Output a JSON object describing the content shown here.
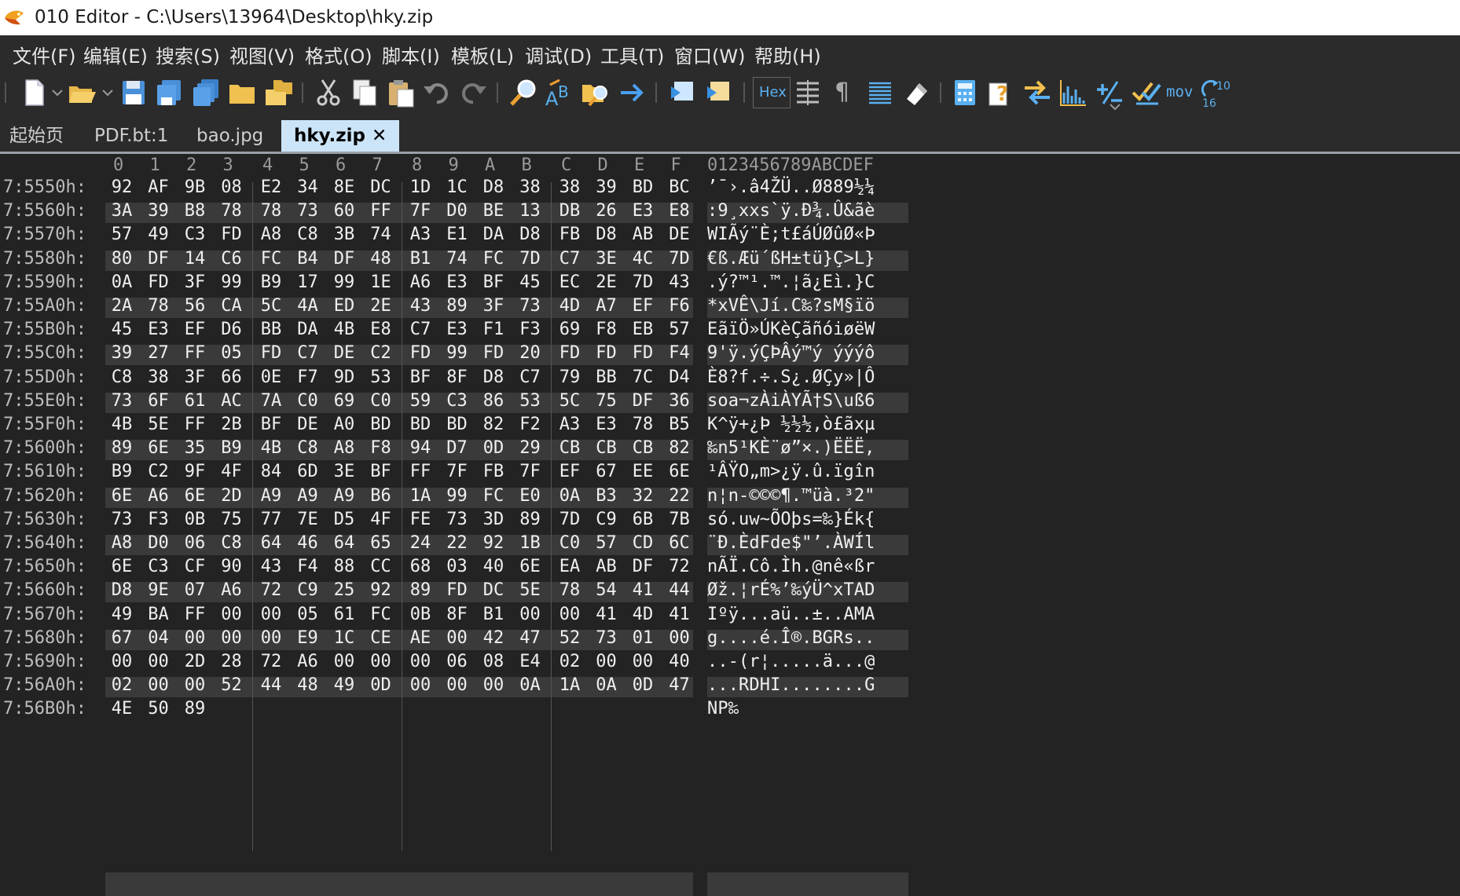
{
  "window": {
    "title": "010 Editor - C:\\Users\\13964\\Desktop\\hky.zip"
  },
  "menu": [
    "文件(F)",
    "编辑(E)",
    "搜索(S)",
    "视图(V)",
    "格式(O)",
    "脚本(I)",
    "模板(L)",
    "调试(D)",
    "工具(T)",
    "窗口(W)",
    "帮助(H)"
  ],
  "toolbar": {
    "hex_label": "Hex",
    "mov_label": "mov",
    "pilcrow": "¶"
  },
  "tabs": [
    {
      "label": "起始页"
    },
    {
      "label": "PDF.bt:1"
    },
    {
      "label": "bao.jpg"
    },
    {
      "label": "hky.zip",
      "close": "✕"
    }
  ],
  "hex_header": {
    "columns": [
      "0",
      "1",
      "2",
      "3",
      "4",
      "5",
      "6",
      "7",
      "8",
      "9",
      "A",
      "B",
      "C",
      "D",
      "E",
      "F"
    ],
    "ascii_header": "0123456789ABCDEF"
  },
  "rows": [
    {
      "addr": "7:5550h:",
      "bytes": [
        "92",
        "AF",
        "9B",
        "08",
        "E2",
        "34",
        "8E",
        "DC",
        "1D",
        "1C",
        "D8",
        "38",
        "38",
        "39",
        "BD",
        "BC"
      ],
      "ascii": "’¯›.â4ŽÜ..Ø889½¼"
    },
    {
      "addr": "7:5560h:",
      "bytes": [
        "3A",
        "39",
        "B8",
        "78",
        "78",
        "73",
        "60",
        "FF",
        "7F",
        "D0",
        "BE",
        "13",
        "DB",
        "26",
        "E3",
        "E8"
      ],
      "ascii": ":9¸xxs`ÿ.Ð¾.Û&ãè"
    },
    {
      "addr": "7:5570h:",
      "bytes": [
        "57",
        "49",
        "C3",
        "FD",
        "A8",
        "C8",
        "3B",
        "74",
        "A3",
        "E1",
        "DA",
        "D8",
        "FB",
        "D8",
        "AB",
        "DE"
      ],
      "ascii": "WIÃý¨È;t£áÚØûØ«Þ"
    },
    {
      "addr": "7:5580h:",
      "bytes": [
        "80",
        "DF",
        "14",
        "C6",
        "FC",
        "B4",
        "DF",
        "48",
        "B1",
        "74",
        "FC",
        "7D",
        "C7",
        "3E",
        "4C",
        "7D"
      ],
      "ascii": "€ß.Æü´ßH±tü}Ç>L}"
    },
    {
      "addr": "7:5590h:",
      "bytes": [
        "0A",
        "FD",
        "3F",
        "99",
        "B9",
        "17",
        "99",
        "1E",
        "A6",
        "E3",
        "BF",
        "45",
        "EC",
        "2E",
        "7D",
        "43"
      ],
      "ascii": ".ý?™¹.™.¦ã¿Eì.}C"
    },
    {
      "addr": "7:55A0h:",
      "bytes": [
        "2A",
        "78",
        "56",
        "CA",
        "5C",
        "4A",
        "ED",
        "2E",
        "43",
        "89",
        "3F",
        "73",
        "4D",
        "A7",
        "EF",
        "F6"
      ],
      "ascii": "*xVÊ\\Jí.C‰?sM§ïö"
    },
    {
      "addr": "7:55B0h:",
      "bytes": [
        "45",
        "E3",
        "EF",
        "D6",
        "BB",
        "DA",
        "4B",
        "E8",
        "C7",
        "E3",
        "F1",
        "F3",
        "69",
        "F8",
        "EB",
        "57"
      ],
      "ascii": "EãïÖ»ÚKèÇãñóiøëW"
    },
    {
      "addr": "7:55C0h:",
      "bytes": [
        "39",
        "27",
        "FF",
        "05",
        "FD",
        "C7",
        "DE",
        "C2",
        "FD",
        "99",
        "FD",
        "20",
        "FD",
        "FD",
        "FD",
        "F4"
      ],
      "ascii": "9'ÿ.ýÇÞÂý™ý ýýýô"
    },
    {
      "addr": "7:55D0h:",
      "bytes": [
        "C8",
        "38",
        "3F",
        "66",
        "0E",
        "F7",
        "9D",
        "53",
        "BF",
        "8F",
        "D8",
        "C7",
        "79",
        "BB",
        "7C",
        "D4"
      ],
      "ascii": "È8?f.÷.S¿.ØÇy»|Ô"
    },
    {
      "addr": "7:55E0h:",
      "bytes": [
        "73",
        "6F",
        "61",
        "AC",
        "7A",
        "C0",
        "69",
        "C0",
        "59",
        "C3",
        "86",
        "53",
        "5C",
        "75",
        "DF",
        "36"
      ],
      "ascii": "soa¬zÀiÀYÃ†S\\uß6"
    },
    {
      "addr": "7:55F0h:",
      "bytes": [
        "4B",
        "5E",
        "FF",
        "2B",
        "BF",
        "DE",
        "A0",
        "BD",
        "BD",
        "BD",
        "82",
        "F2",
        "A3",
        "E3",
        "78",
        "B5"
      ],
      "ascii": "K^ÿ+¿Þ ½½½‚ò£ãxµ"
    },
    {
      "addr": "7:5600h:",
      "bytes": [
        "89",
        "6E",
        "35",
        "B9",
        "4B",
        "C8",
        "A8",
        "F8",
        "94",
        "D7",
        "0D",
        "29",
        "CB",
        "CB",
        "CB",
        "82"
      ],
      "ascii": "‰n5¹KÈ¨ø”×.)ËËË‚"
    },
    {
      "addr": "7:5610h:",
      "bytes": [
        "B9",
        "C2",
        "9F",
        "4F",
        "84",
        "6D",
        "3E",
        "BF",
        "FF",
        "7F",
        "FB",
        "7F",
        "EF",
        "67",
        "EE",
        "6E"
      ],
      "ascii": "¹ÂŸO„m>¿ÿ.û.ïgîn"
    },
    {
      "addr": "7:5620h:",
      "bytes": [
        "6E",
        "A6",
        "6E",
        "2D",
        "A9",
        "A9",
        "A9",
        "B6",
        "1A",
        "99",
        "FC",
        "E0",
        "0A",
        "B3",
        "32",
        "22"
      ],
      "ascii": "n¦n-©©©¶.™üà.³2\""
    },
    {
      "addr": "7:5630h:",
      "bytes": [
        "73",
        "F3",
        "0B",
        "75",
        "77",
        "7E",
        "D5",
        "4F",
        "FE",
        "73",
        "3D",
        "89",
        "7D",
        "C9",
        "6B",
        "7B"
      ],
      "ascii": "só.uw~ÕOþs=‰}Ék{"
    },
    {
      "addr": "7:5640h:",
      "bytes": [
        "A8",
        "D0",
        "06",
        "C8",
        "64",
        "46",
        "64",
        "65",
        "24",
        "22",
        "92",
        "1B",
        "C0",
        "57",
        "CD",
        "6C"
      ],
      "ascii": "¨Ð.ÈdFde$\"’.ÀWÍl"
    },
    {
      "addr": "7:5650h:",
      "bytes": [
        "6E",
        "C3",
        "CF",
        "90",
        "43",
        "F4",
        "88",
        "CC",
        "68",
        "03",
        "40",
        "6E",
        "EA",
        "AB",
        "DF",
        "72"
      ],
      "ascii": "nÃÏ.Cô.Ìh.@nê«ßr"
    },
    {
      "addr": "7:5660h:",
      "bytes": [
        "D8",
        "9E",
        "07",
        "A6",
        "72",
        "C9",
        "25",
        "92",
        "89",
        "FD",
        "DC",
        "5E",
        "78",
        "54",
        "41",
        "44"
      ],
      "ascii": "Øž.¦rÉ%’‰ýÜ^xTAD"
    },
    {
      "addr": "7:5670h:",
      "bytes": [
        "49",
        "BA",
        "FF",
        "00",
        "00",
        "05",
        "61",
        "FC",
        "0B",
        "8F",
        "B1",
        "00",
        "00",
        "41",
        "4D",
        "41"
      ],
      "ascii": "Iºÿ...aü..±..AMA"
    },
    {
      "addr": "7:5680h:",
      "bytes": [
        "67",
        "04",
        "00",
        "00",
        "00",
        "E9",
        "1C",
        "CE",
        "AE",
        "00",
        "42",
        "47",
        "52",
        "73",
        "01",
        "00"
      ],
      "ascii": "g....é.Î®.BGRs.."
    },
    {
      "addr": "7:5690h:",
      "bytes": [
        "00",
        "00",
        "2D",
        "28",
        "72",
        "A6",
        "00",
        "00",
        "00",
        "06",
        "08",
        "E4",
        "02",
        "00",
        "00",
        "40"
      ],
      "ascii": "..-(r¦.....ä...@"
    },
    {
      "addr": "7:56A0h:",
      "bytes": [
        "02",
        "00",
        "00",
        "52",
        "44",
        "48",
        "49",
        "0D",
        "00",
        "00",
        "00",
        "0A",
        "1A",
        "0A",
        "0D",
        "47"
      ],
      "ascii": "...RDHI........G"
    },
    {
      "addr": "7:56B0h:",
      "bytes": [
        "4E",
        "50",
        "89"
      ],
      "ascii": "NP‰"
    }
  ]
}
